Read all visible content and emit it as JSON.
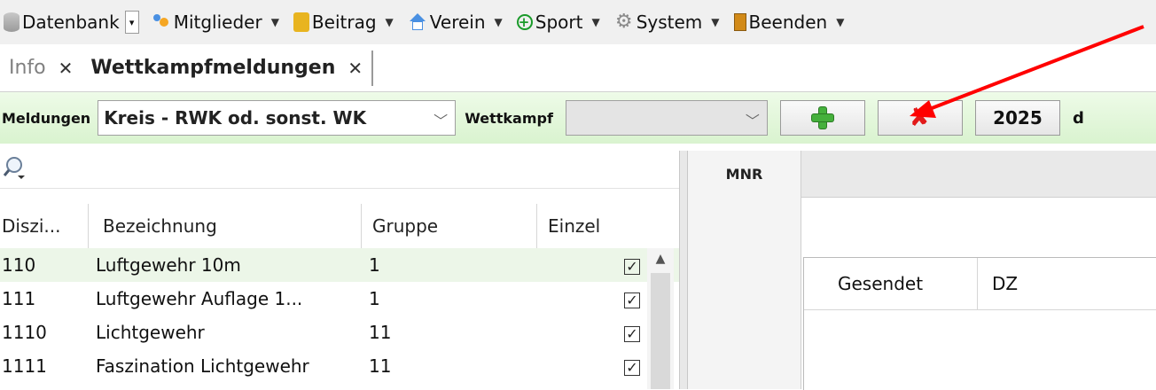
{
  "menu": {
    "items": [
      {
        "label": "Datenbank",
        "icon": "database-icon"
      },
      {
        "label": "Mitglieder",
        "icon": "members-icon"
      },
      {
        "label": "Beitrag",
        "icon": "coins-icon"
      },
      {
        "label": "Verein",
        "icon": "house-icon"
      },
      {
        "label": "Sport",
        "icon": "sport-plus-icon"
      },
      {
        "label": "System",
        "icon": "gear-icon"
      },
      {
        "label": "Beenden",
        "icon": "door-icon"
      }
    ]
  },
  "tabs": [
    {
      "label": "Info",
      "active": false
    },
    {
      "label": "Wettkampfmeldungen",
      "active": true
    }
  ],
  "toolbar": {
    "meldungen_label": "Meldungen",
    "meldungen_value": "Kreis - RWK od. sonst. WK",
    "wettkampf_label": "Wettkampf",
    "wettkampf_value": "",
    "year": "2025",
    "trailing_text": "d"
  },
  "grid": {
    "columns": [
      "Diszi...",
      "Bezeichnung",
      "Gruppe",
      "Einzel"
    ],
    "rows": [
      {
        "disziplin": "110",
        "bezeichnung": "Luftgewehr 10m",
        "gruppe": "1",
        "einzel": true
      },
      {
        "disziplin": "111",
        "bezeichnung": "Luftgewehr Auflage 1...",
        "gruppe": "1",
        "einzel": true
      },
      {
        "disziplin": "1110",
        "bezeichnung": "Lichtgewehr",
        "gruppe": "11",
        "einzel": true
      },
      {
        "disziplin": "1111",
        "bezeichnung": "Faszination Lichtgewehr",
        "gruppe": "11",
        "einzel": true
      }
    ]
  },
  "right_pane": {
    "mnr_header": "MNR",
    "subgrid_columns": [
      "Gesendet",
      "DZ"
    ]
  },
  "colors": {
    "toolbar_green": "#d9f3cf",
    "annotation_arrow": "#ff0000",
    "plus_green": "#45b03c",
    "delete_red": "#e21a1a"
  }
}
